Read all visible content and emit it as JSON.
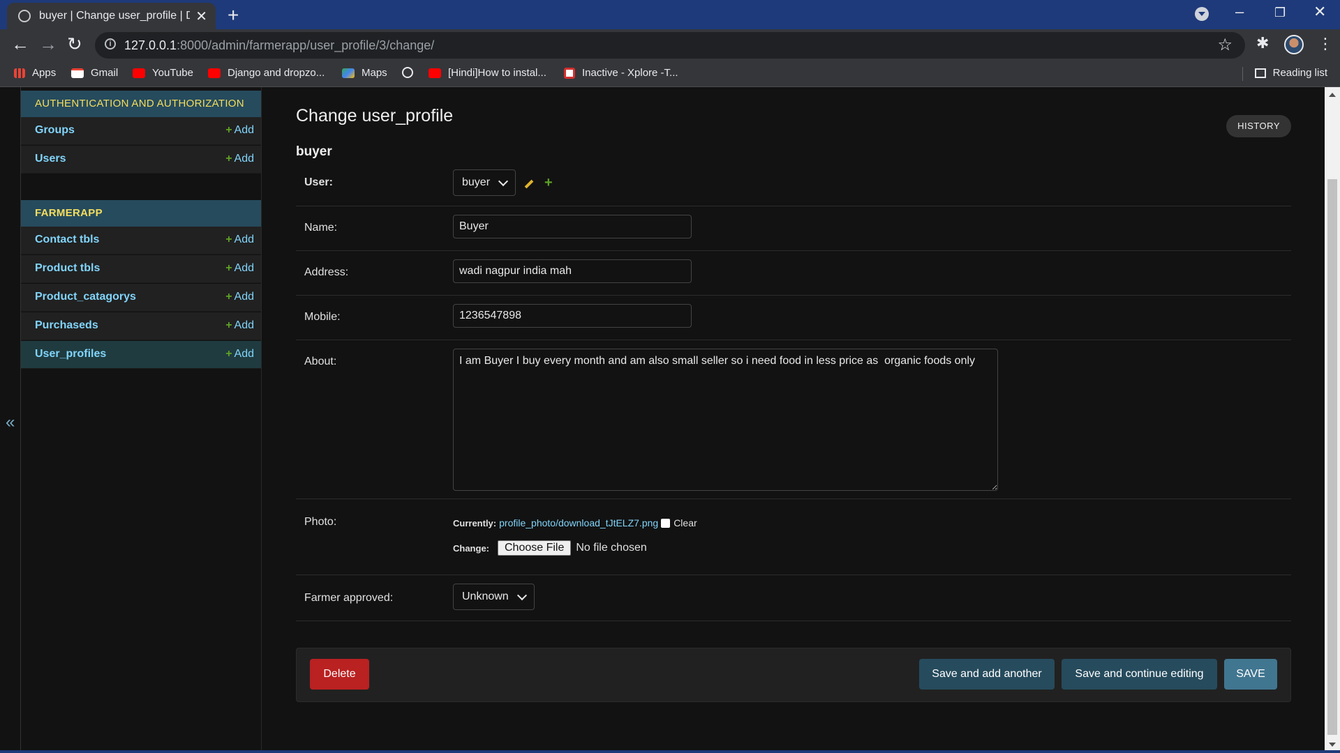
{
  "browser": {
    "tab_title": "buyer | Change user_profile | Django",
    "url_host": "127.0.0.1",
    "url_rest": ":8000/admin/farmerapp/user_profile/3/change/",
    "bookmarks": [
      "Apps",
      "Gmail",
      "YouTube",
      "Django and dropzo...",
      "Maps",
      "[Hindi]How to instal...",
      "Inactive - Xplore -T..."
    ],
    "reading_list": "Reading list"
  },
  "sidebar": {
    "auth_caption": "AUTHENTICATION AND AUTHORIZATION",
    "auth_items": [
      {
        "label": "Groups",
        "add": "Add"
      },
      {
        "label": "Users",
        "add": "Add"
      }
    ],
    "app_caption": "FARMERAPP",
    "app_items": [
      {
        "label": "Contact tbls",
        "add": "Add"
      },
      {
        "label": "Product tbls",
        "add": "Add"
      },
      {
        "label": "Product_catagorys",
        "add": "Add"
      },
      {
        "label": "Purchaseds",
        "add": "Add"
      },
      {
        "label": "User_profiles",
        "add": "Add"
      }
    ],
    "collapse_glyph": "«"
  },
  "content": {
    "title": "Change user_profile",
    "history": "HISTORY",
    "object_name": "buyer",
    "fields": {
      "user_label": "User:",
      "user_value": "buyer",
      "name_label": "Name:",
      "name_value": "Buyer",
      "address_label": "Address:",
      "address_value": "wadi nagpur india mah",
      "mobile_label": "Mobile:",
      "mobile_value": "1236547898",
      "about_label": "About:",
      "about_value": "I am Buyer I buy every month and am also small seller so i need food in less price as  organic foods only",
      "photo_label": "Photo:",
      "photo_currently": "Currently:",
      "photo_file": "profile_photo/download_tJtELZ7.png",
      "photo_clear": "Clear",
      "photo_change": "Change:",
      "choose_file": "Choose File",
      "no_file": "No file chosen",
      "farmer_approved_label": "Farmer approved:",
      "farmer_approved_value": "Unknown"
    },
    "buttons": {
      "delete": "Delete",
      "save_add": "Save and add another",
      "save_continue": "Save and continue editing",
      "save": "SAVE"
    }
  },
  "colors": {
    "module_caption_bg": "#264b5d",
    "link": "#81d4fa",
    "add_green": "#5fa225",
    "delete_red": "#ba2121",
    "save_blue": "#417690"
  }
}
